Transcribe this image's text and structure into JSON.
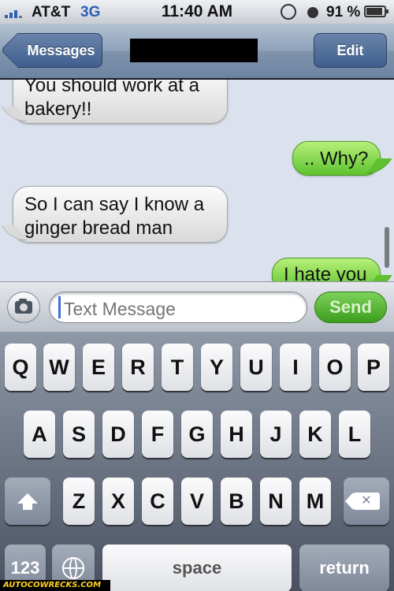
{
  "status_bar": {
    "carrier": "AT&T",
    "network": "3G",
    "time": "11:40 AM",
    "battery": "91 %"
  },
  "nav": {
    "back_label": "Messages",
    "edit_label": "Edit"
  },
  "messages": [
    {
      "direction": "incoming",
      "text": "You should work at a bakery!!"
    },
    {
      "direction": "outgoing",
      "text": ".. Why?"
    },
    {
      "direction": "incoming",
      "text": "So I can say I know a ginger bread man"
    },
    {
      "direction": "outgoing",
      "text": "I hate you"
    }
  ],
  "compose": {
    "placeholder": "Text Message",
    "send_label": "Send"
  },
  "keyboard": {
    "row1": [
      "Q",
      "W",
      "E",
      "R",
      "T",
      "Y",
      "U",
      "I",
      "O",
      "P"
    ],
    "row2": [
      "A",
      "S",
      "D",
      "F",
      "G",
      "H",
      "J",
      "K",
      "L"
    ],
    "row3": [
      "Z",
      "X",
      "C",
      "V",
      "B",
      "N",
      "M"
    ],
    "numbers_label": "123",
    "space_label": "space",
    "return_label": "return"
  },
  "watermark": "AUTOCOWRECKS.COM",
  "colors": {
    "outgoing_bubble": "#7ed348",
    "incoming_bubble": "#ececec",
    "nav_button": "#4d6c9a",
    "send_button": "#56b32f"
  }
}
